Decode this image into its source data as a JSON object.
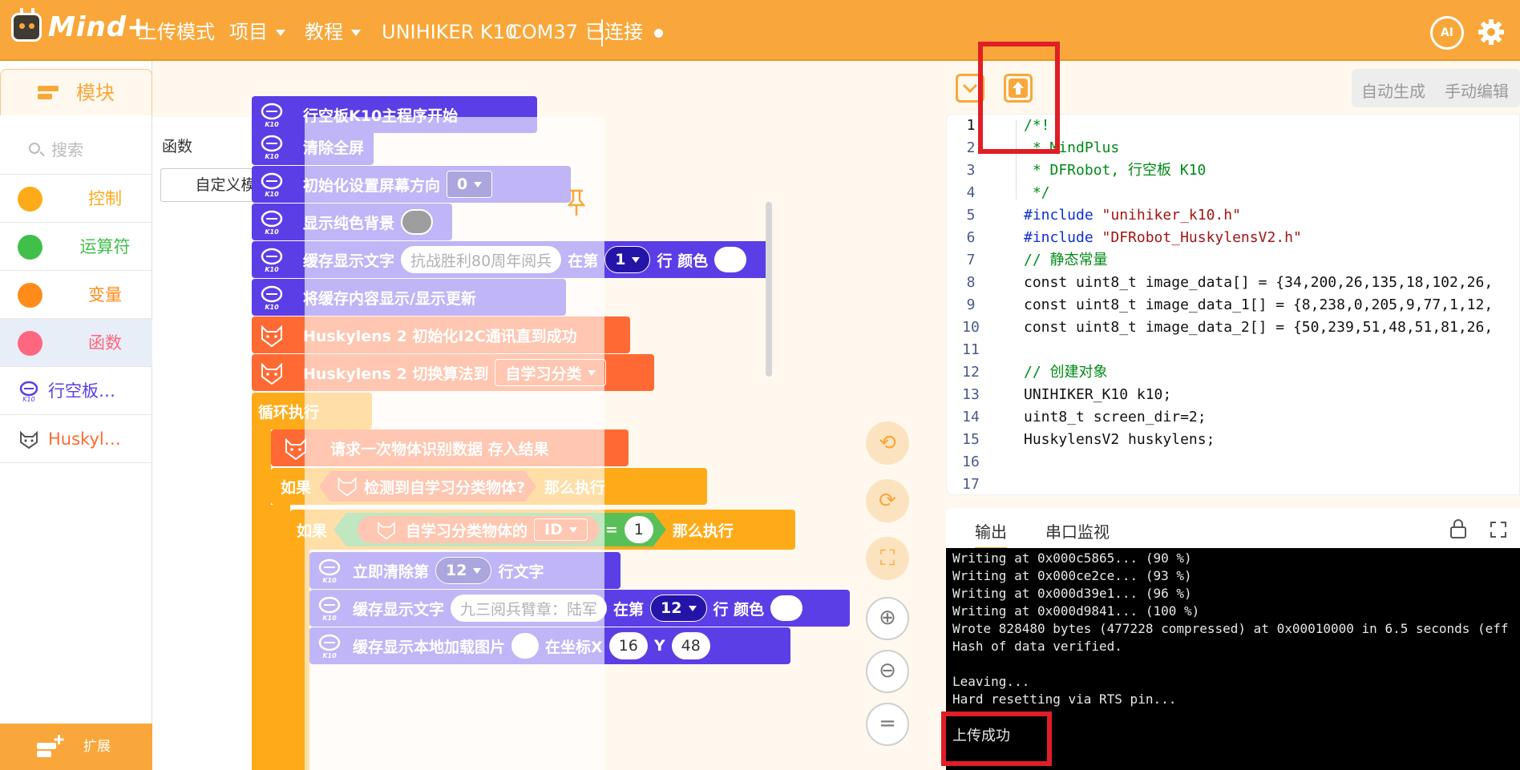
{
  "topbar": {
    "app_name": "Mind+",
    "menu": [
      {
        "label": "上传模式"
      },
      {
        "label": "项目"
      },
      {
        "label": "教程"
      }
    ],
    "board": "UNIHIKER K10",
    "port": "COM37",
    "status": "已连接",
    "ai_label": "AI"
  },
  "sidebar": {
    "tab_label": "模块",
    "search_placeholder": "搜索",
    "categories": [
      {
        "label": "控制",
        "color": "#ffab19"
      },
      {
        "label": "运算符",
        "color": "#40bf4a"
      },
      {
        "label": "变量",
        "color": "#ff8c1a"
      },
      {
        "label": "函数",
        "color": "#ff6680"
      },
      {
        "label": "行空板…"
      },
      {
        "label": "Huskyl…"
      }
    ],
    "extension_label": "扩展"
  },
  "flyout": {
    "heading": "函数",
    "custom_block": "自定义模块"
  },
  "blocks": {
    "b1": "行空板K10主程序开始",
    "b2": "清除全屏",
    "b3": "初始化设置屏幕方向",
    "b3_val": "0",
    "b4": "显示纯色背景",
    "b5_a": "缓存显示文字",
    "b5_text": "抗战胜利80周年阅兵",
    "b5_b": "在第",
    "b5_row": "1",
    "b5_c": "行 颜色",
    "b6": "将缓存内容显示/显示更新",
    "b7": "Huskylens 2 初始化I2C通讯直到成功",
    "b8_a": "Huskylens 2 切换算法到",
    "b8_val": "自学习分类",
    "b9": "循环执行",
    "b10": "请求一次物体识别数据 存入结果",
    "b11_a": "如果",
    "b11_b": "检测到自学习分类物体?",
    "b11_c": "那么执行",
    "b12_a": "如果",
    "b12_b": "自学习分类物体的",
    "b12_val": "ID",
    "b12_eq": "=",
    "b12_num": "1",
    "b12_c": "那么执行",
    "b13_a": "立即清除第",
    "b13_row": "12",
    "b13_b": "行文字",
    "b14_a": "缓存显示文字",
    "b14_text": "九三阅兵臂章：陆军",
    "b14_b": "在第",
    "b14_row": "12",
    "b14_c": "行 颜色",
    "b15_a": "缓存显示本地加载图片",
    "b15_b": "在坐标X",
    "b15_x": "16",
    "b15_c": "Y",
    "b15_y": "48"
  },
  "code_panel": {
    "mode_auto": "自动生成",
    "mode_manual": "手动编辑",
    "lines": [
      {
        "n": "1",
        "text": "/*!"
      },
      {
        "n": "2",
        "text": " * MindPlus"
      },
      {
        "n": "3",
        "text": " * DFRobot, 行空板 K10"
      },
      {
        "n": "4",
        "text": " */"
      },
      {
        "n": "5",
        "kw": "#include",
        "str": " \"unihiker_k10.h\""
      },
      {
        "n": "6",
        "kw": "#include",
        "str": " \"DFRobot_HuskylensV2.h\""
      },
      {
        "n": "7",
        "text": "// 静态常量"
      },
      {
        "n": "8",
        "text": "const uint8_t image_data[] = {34,200,26,135,18,102,26,"
      },
      {
        "n": "9",
        "text": "const uint8_t image_data_1[] = {8,238,0,205,9,77,1,12,"
      },
      {
        "n": "10",
        "text": "const uint8_t image_data_2[] = {50,239,51,48,51,81,26,"
      },
      {
        "n": "11",
        "text": ""
      },
      {
        "n": "12",
        "text": "// 创建对象"
      },
      {
        "n": "13",
        "text": "UNIHIKER_K10 k10;"
      },
      {
        "n": "14",
        "text": "uint8_t screen_dir=2;"
      },
      {
        "n": "15",
        "text": "HuskylensV2 huskylens;"
      },
      {
        "n": "16",
        "text": ""
      },
      {
        "n": "17",
        "text": ""
      }
    ]
  },
  "output": {
    "tab_output": "输出",
    "tab_serial": "串口监视",
    "lines": [
      "Writing at 0x000c5865... (90 %)",
      "Writing at 0x000ce2ce... (93 %)",
      "Writing at 0x000d39e1... (96 %)",
      "Writing at 0x000d9841... (100 %)",
      "Wrote 828480 bytes (477228 compressed) at 0x00010000 in 6.5 seconds (eff",
      "Hash of data verified.",
      "",
      "Leaving...",
      "Hard resetting via RTS pin...",
      "",
      "上传成功"
    ]
  },
  "colors": {
    "accent": "#f9a73a",
    "k10_block": "#5b3ee6",
    "husky_block": "#ff6a34",
    "control_block": "#ffab19",
    "operator_block": "#59c059",
    "annotation": "#e01e27"
  }
}
